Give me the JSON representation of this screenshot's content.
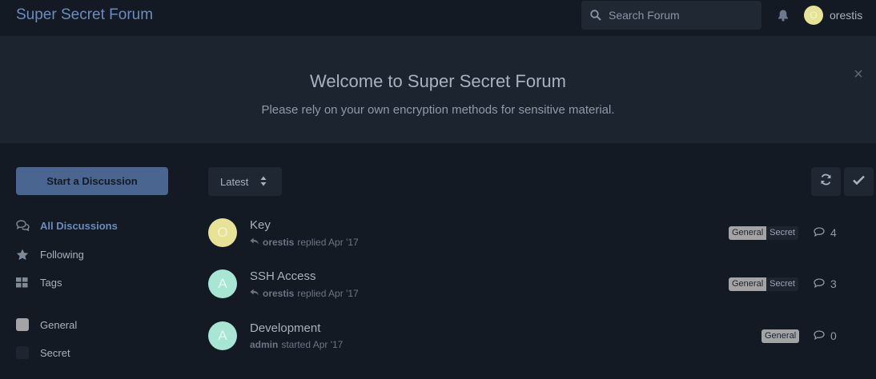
{
  "header": {
    "site_title": "Super Secret Forum",
    "search_placeholder": "Search Forum",
    "username": "orestis",
    "user_initial": "O"
  },
  "hero": {
    "title": "Welcome to Super Secret Forum",
    "subtitle": "Please rely on your own encryption methods for sensitive material.",
    "close": "×"
  },
  "sidebar": {
    "start_button": "Start a Discussion",
    "nav": [
      {
        "label": "All Discussions",
        "icon": "comments-icon",
        "active": true
      },
      {
        "label": "Following",
        "icon": "star-icon",
        "active": false
      },
      {
        "label": "Tags",
        "icon": "tags-grid-icon",
        "active": false
      }
    ],
    "tags": [
      {
        "label": "General",
        "color": "#a4a4a4"
      },
      {
        "label": "Secret",
        "color": "#1d2530"
      }
    ]
  },
  "toolbar": {
    "sort_label": "Latest"
  },
  "discussions": [
    {
      "initial": "O",
      "avatar_color": "#e6e396",
      "title": "Key",
      "user": "orestis",
      "action": "replied Apr '17",
      "reply_icon": true,
      "tags": [
        "General",
        "Secret"
      ],
      "count": "4"
    },
    {
      "initial": "A",
      "avatar_color": "#a6e6d3",
      "title": "SSH Access",
      "user": "orestis",
      "action": "replied Apr '17",
      "reply_icon": true,
      "tags": [
        "General",
        "Secret"
      ],
      "count": "3"
    },
    {
      "initial": "A",
      "avatar_color": "#a6e6d3",
      "title": "Development",
      "user": "admin",
      "action": "started Apr '17",
      "reply_icon": false,
      "tags": [
        "General"
      ],
      "count": "0"
    }
  ]
}
